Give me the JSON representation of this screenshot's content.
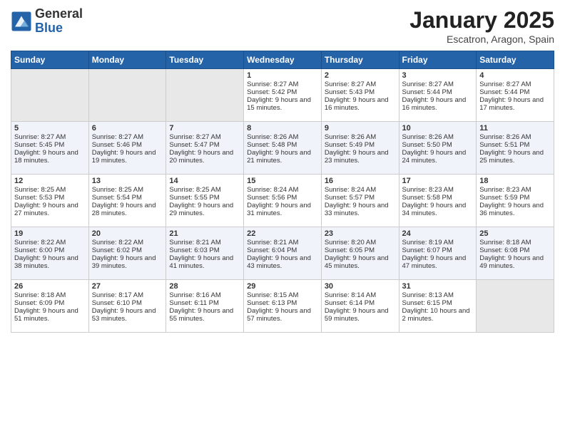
{
  "header": {
    "logo_general": "General",
    "logo_blue": "Blue",
    "month": "January 2025",
    "location": "Escatron, Aragon, Spain"
  },
  "days_of_week": [
    "Sunday",
    "Monday",
    "Tuesday",
    "Wednesday",
    "Thursday",
    "Friday",
    "Saturday"
  ],
  "weeks": [
    [
      {
        "day": "",
        "empty": true
      },
      {
        "day": "",
        "empty": true
      },
      {
        "day": "",
        "empty": true
      },
      {
        "day": "1",
        "sunrise": "8:27 AM",
        "sunset": "5:42 PM",
        "daylight": "9 hours and 15 minutes."
      },
      {
        "day": "2",
        "sunrise": "8:27 AM",
        "sunset": "5:43 PM",
        "daylight": "9 hours and 16 minutes."
      },
      {
        "day": "3",
        "sunrise": "8:27 AM",
        "sunset": "5:44 PM",
        "daylight": "9 hours and 16 minutes."
      },
      {
        "day": "4",
        "sunrise": "8:27 AM",
        "sunset": "5:44 PM",
        "daylight": "9 hours and 17 minutes."
      }
    ],
    [
      {
        "day": "5",
        "sunrise": "8:27 AM",
        "sunset": "5:45 PM",
        "daylight": "9 hours and 18 minutes."
      },
      {
        "day": "6",
        "sunrise": "8:27 AM",
        "sunset": "5:46 PM",
        "daylight": "9 hours and 19 minutes."
      },
      {
        "day": "7",
        "sunrise": "8:27 AM",
        "sunset": "5:47 PM",
        "daylight": "9 hours and 20 minutes."
      },
      {
        "day": "8",
        "sunrise": "8:26 AM",
        "sunset": "5:48 PM",
        "daylight": "9 hours and 21 minutes."
      },
      {
        "day": "9",
        "sunrise": "8:26 AM",
        "sunset": "5:49 PM",
        "daylight": "9 hours and 23 minutes."
      },
      {
        "day": "10",
        "sunrise": "8:26 AM",
        "sunset": "5:50 PM",
        "daylight": "9 hours and 24 minutes."
      },
      {
        "day": "11",
        "sunrise": "8:26 AM",
        "sunset": "5:51 PM",
        "daylight": "9 hours and 25 minutes."
      }
    ],
    [
      {
        "day": "12",
        "sunrise": "8:25 AM",
        "sunset": "5:53 PM",
        "daylight": "9 hours and 27 minutes."
      },
      {
        "day": "13",
        "sunrise": "8:25 AM",
        "sunset": "5:54 PM",
        "daylight": "9 hours and 28 minutes."
      },
      {
        "day": "14",
        "sunrise": "8:25 AM",
        "sunset": "5:55 PM",
        "daylight": "9 hours and 29 minutes."
      },
      {
        "day": "15",
        "sunrise": "8:24 AM",
        "sunset": "5:56 PM",
        "daylight": "9 hours and 31 minutes."
      },
      {
        "day": "16",
        "sunrise": "8:24 AM",
        "sunset": "5:57 PM",
        "daylight": "9 hours and 33 minutes."
      },
      {
        "day": "17",
        "sunrise": "8:23 AM",
        "sunset": "5:58 PM",
        "daylight": "9 hours and 34 minutes."
      },
      {
        "day": "18",
        "sunrise": "8:23 AM",
        "sunset": "5:59 PM",
        "daylight": "9 hours and 36 minutes."
      }
    ],
    [
      {
        "day": "19",
        "sunrise": "8:22 AM",
        "sunset": "6:00 PM",
        "daylight": "9 hours and 38 minutes."
      },
      {
        "day": "20",
        "sunrise": "8:22 AM",
        "sunset": "6:02 PM",
        "daylight": "9 hours and 39 minutes."
      },
      {
        "day": "21",
        "sunrise": "8:21 AM",
        "sunset": "6:03 PM",
        "daylight": "9 hours and 41 minutes."
      },
      {
        "day": "22",
        "sunrise": "8:21 AM",
        "sunset": "6:04 PM",
        "daylight": "9 hours and 43 minutes."
      },
      {
        "day": "23",
        "sunrise": "8:20 AM",
        "sunset": "6:05 PM",
        "daylight": "9 hours and 45 minutes."
      },
      {
        "day": "24",
        "sunrise": "8:19 AM",
        "sunset": "6:07 PM",
        "daylight": "9 hours and 47 minutes."
      },
      {
        "day": "25",
        "sunrise": "8:18 AM",
        "sunset": "6:08 PM",
        "daylight": "9 hours and 49 minutes."
      }
    ],
    [
      {
        "day": "26",
        "sunrise": "8:18 AM",
        "sunset": "6:09 PM",
        "daylight": "9 hours and 51 minutes."
      },
      {
        "day": "27",
        "sunrise": "8:17 AM",
        "sunset": "6:10 PM",
        "daylight": "9 hours and 53 minutes."
      },
      {
        "day": "28",
        "sunrise": "8:16 AM",
        "sunset": "6:11 PM",
        "daylight": "9 hours and 55 minutes."
      },
      {
        "day": "29",
        "sunrise": "8:15 AM",
        "sunset": "6:13 PM",
        "daylight": "9 hours and 57 minutes."
      },
      {
        "day": "30",
        "sunrise": "8:14 AM",
        "sunset": "6:14 PM",
        "daylight": "9 hours and 59 minutes."
      },
      {
        "day": "31",
        "sunrise": "8:13 AM",
        "sunset": "6:15 PM",
        "daylight": "10 hours and 2 minutes."
      },
      {
        "day": "",
        "empty": true
      }
    ]
  ]
}
